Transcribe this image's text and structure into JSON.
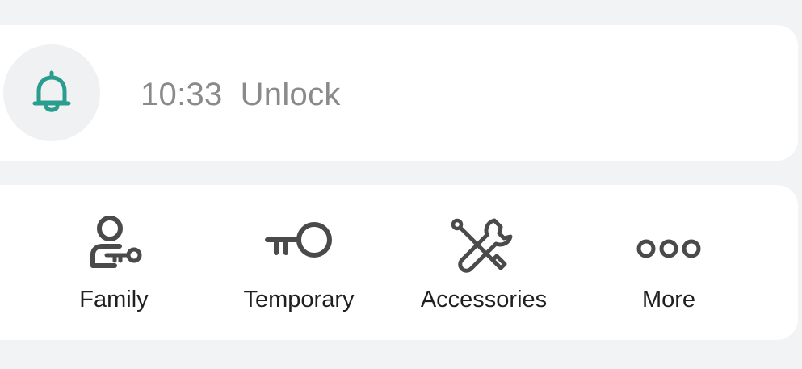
{
  "notice": {
    "time": "10:33",
    "message": "Unlock",
    "icon": "bell-icon",
    "accent_color": "#2a9d8f"
  },
  "actions": [
    {
      "label": "Family",
      "icon": "family-key-icon"
    },
    {
      "label": "Temporary",
      "icon": "key-icon"
    },
    {
      "label": "Accessories",
      "icon": "tools-icon"
    },
    {
      "label": "More",
      "icon": "more-dots-icon"
    }
  ]
}
